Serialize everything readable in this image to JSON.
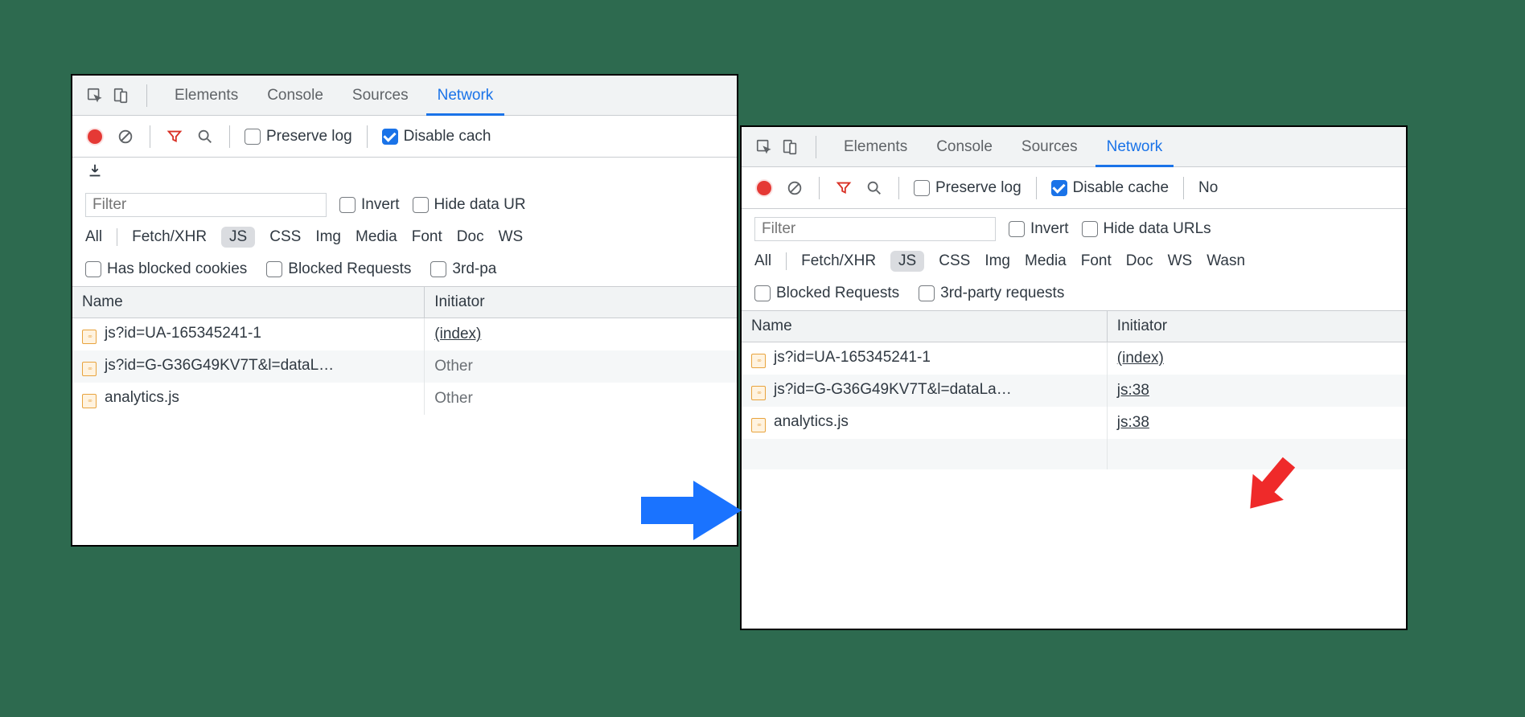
{
  "tabs": {
    "elements": "Elements",
    "console": "Console",
    "sources": "Sources",
    "network": "Network"
  },
  "toolbar": {
    "preserve": "Preserve log",
    "disable_left": "Disable cach",
    "disable_right": "Disable cache",
    "no": "No"
  },
  "filter": {
    "placeholder": "Filter",
    "invert": "Invert",
    "hide_left": "Hide data UR",
    "hide_right": "Hide data URLs"
  },
  "chips": {
    "all": "All",
    "fetch": "Fetch/XHR",
    "js": "JS",
    "css": "CSS",
    "img": "Img",
    "media": "Media",
    "font": "Font",
    "doc": "Doc",
    "ws": "WS",
    "wasm": "Wasn"
  },
  "checks": {
    "has_blocked": "Has blocked cookies",
    "blocked_req": "Blocked Requests",
    "third_party_left": "3rd-pa",
    "third_party_right": "3rd-party requests"
  },
  "table": {
    "name": "Name",
    "initiator": "Initiator"
  },
  "left_rows": [
    {
      "name": "js?id=UA-165345241-1",
      "initiator": "(index)",
      "link": true
    },
    {
      "name": "js?id=G-G36G49KV7T&l=dataL…",
      "initiator": "Other",
      "link": false
    },
    {
      "name": "analytics.js",
      "initiator": "Other",
      "link": false
    }
  ],
  "right_rows": [
    {
      "name": "js?id=UA-165345241-1",
      "initiator": "(index)"
    },
    {
      "name": "js?id=G-G36G49KV7T&l=dataLa…",
      "initiator": "js:38"
    },
    {
      "name": "analytics.js",
      "initiator": "js:38"
    }
  ]
}
